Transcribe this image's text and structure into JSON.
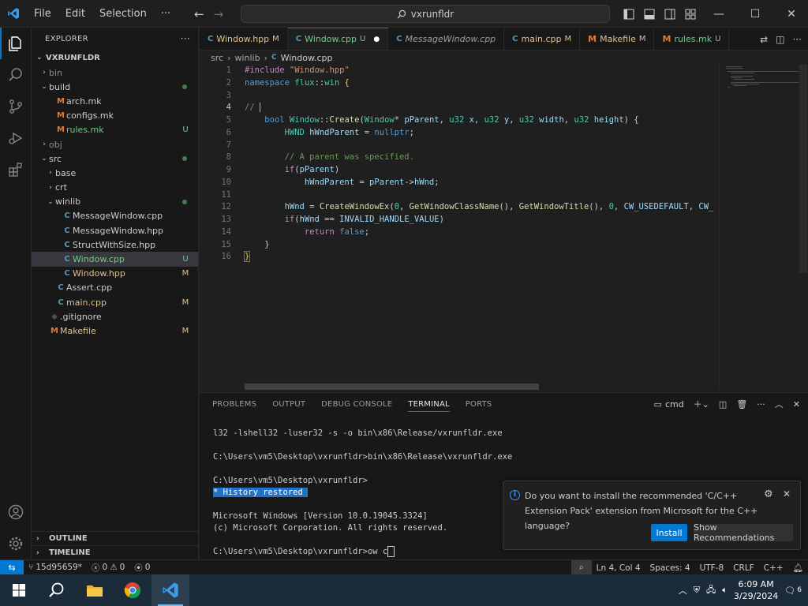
{
  "menu": {
    "file": "File",
    "edit": "Edit",
    "selection": "Selection",
    "more": "···"
  },
  "search": {
    "text": "vxrunfldr"
  },
  "explorer": {
    "title": "EXPLORER",
    "root": "VXRUNFLDR",
    "items": [
      {
        "label": "bin",
        "type": "folder",
        "open": false,
        "indent": 0,
        "dim": true
      },
      {
        "label": "build",
        "type": "folder",
        "open": true,
        "indent": 0,
        "dot": true
      },
      {
        "label": "arch.mk",
        "type": "mk",
        "indent": 1
      },
      {
        "label": "configs.mk",
        "type": "mk",
        "indent": 1
      },
      {
        "label": "rules.mk",
        "type": "mk",
        "indent": 1,
        "status": "U"
      },
      {
        "label": "obj",
        "type": "folder",
        "open": false,
        "indent": 0,
        "dim": true
      },
      {
        "label": "src",
        "type": "folder",
        "open": true,
        "indent": 0,
        "dot": true
      },
      {
        "label": "base",
        "type": "folder",
        "open": false,
        "indent": 1
      },
      {
        "label": "crt",
        "type": "folder",
        "open": false,
        "indent": 1
      },
      {
        "label": "winlib",
        "type": "folder",
        "open": true,
        "indent": 1,
        "dot": true
      },
      {
        "label": "MessageWindow.cpp",
        "type": "cpp",
        "indent": 2
      },
      {
        "label": "MessageWindow.hpp",
        "type": "cpp",
        "indent": 2
      },
      {
        "label": "StructWithSize.hpp",
        "type": "cpp",
        "indent": 2
      },
      {
        "label": "Window.cpp",
        "type": "cpp",
        "indent": 2,
        "status": "U",
        "selected": true
      },
      {
        "label": "Window.hpp",
        "type": "cpp",
        "indent": 2,
        "status": "M"
      },
      {
        "label": "Assert.cpp",
        "type": "cpp",
        "indent": 1
      },
      {
        "label": "main.cpp",
        "type": "cpp",
        "indent": 1,
        "status": "M"
      },
      {
        "label": ".gitignore",
        "type": "git",
        "indent": 0
      },
      {
        "label": "Makefile",
        "type": "make",
        "indent": 0,
        "status": "M"
      }
    ],
    "outline": "OUTLINE",
    "timeline": "TIMELINE"
  },
  "tabs": [
    {
      "name": "Window.hpp",
      "status": "M",
      "icon": "cpp"
    },
    {
      "name": "Window.cpp",
      "status": "U",
      "icon": "cpp",
      "active": true,
      "dirty": true
    },
    {
      "name": "MessageWindow.cpp",
      "status": "",
      "icon": "cpp",
      "italic": true
    },
    {
      "name": "main.cpp",
      "status": "M",
      "icon": "cpp"
    },
    {
      "name": "Makefile",
      "status": "M",
      "icon": "make"
    },
    {
      "name": "rules.mk",
      "status": "U",
      "icon": "make"
    }
  ],
  "breadcrumb": {
    "a": "src",
    "b": "winlib",
    "c": "Window.cpp"
  },
  "code": {
    "line_numbers": [
      "1",
      "2",
      "3",
      "4",
      "5",
      "6",
      "7",
      "8",
      "9",
      "10",
      "11",
      "12",
      "13",
      "14",
      "15",
      "16"
    ],
    "current_line": 4
  },
  "panel": {
    "tabs": [
      "PROBLEMS",
      "OUTPUT",
      "DEBUG CONSOLE",
      "TERMINAL",
      "PORTS"
    ],
    "active_tab": "TERMINAL",
    "shell": "cmd",
    "terminal_lines": [
      "l32 -lshell32 -luser32 -s -o bin\\x86\\Release/vxrunfldr.exe",
      "",
      "C:\\Users\\vm5\\Desktop\\vxrunfldr>bin\\x86\\Release\\vxrunfldr.exe",
      "",
      "C:\\Users\\vm5\\Desktop\\vxrunfldr>",
      "",
      "",
      "Microsoft Windows [Version 10.0.19045.3324]",
      "(c) Microsoft Corporation. All rights reserved.",
      "",
      "C:\\Users\\vm5\\Desktop\\vxrunfldr>ow c"
    ],
    "history_marker": "*",
    "history_text": " History restored "
  },
  "notification": {
    "message": "Do you want to install the recommended 'C/C++ Extension Pack' extension from Microsoft for the C++ language?",
    "install": "Install",
    "show_recommendations": "Show Recommendations"
  },
  "status": {
    "branch": "15d95659*",
    "errors": "0",
    "warnings": "0",
    "ports": "0",
    "position": "Ln 4, Col 4",
    "spaces": "Spaces: 4",
    "encoding": "UTF-8",
    "eol": "CRLF",
    "language": "C++"
  },
  "taskbar": {
    "time": "6:09 AM",
    "date": "3/29/2024",
    "notifications": "6"
  },
  "colors": {
    "accent": "#0078d4",
    "modified": "#e2c08d",
    "untracked": "#73c991"
  }
}
